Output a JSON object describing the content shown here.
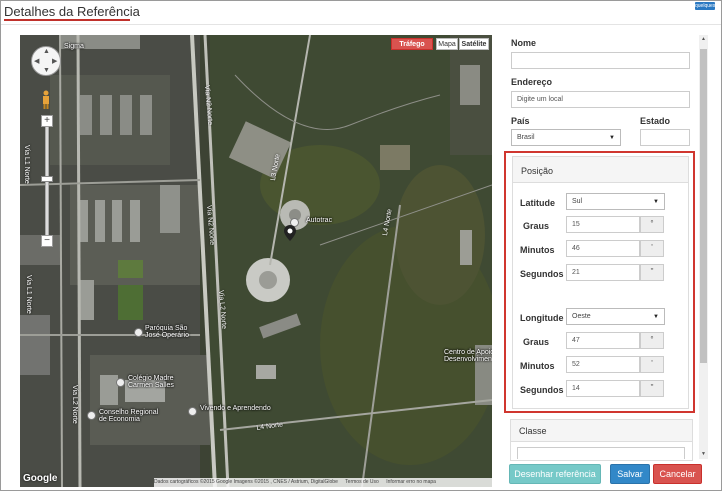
{
  "window": {
    "title": "Detalhes da Referência",
    "badge": "quelques"
  },
  "map": {
    "buttons": {
      "traffic": "Tráfego",
      "map": "Mapa",
      "satellite": "Satélite"
    },
    "labels": {
      "sigma": "Sigma",
      "autotrac": "Autotrac",
      "paroquia": "Paróquia São\nJosé Operário",
      "colegio": "Colégio Madre\nCarmen Salles",
      "conselho": "Conselho Regional\nde Economia",
      "vivendo": "Vivendo e Aprendendo",
      "centro": "Centro de Apoio\nDesenvolvimen"
    },
    "roads": {
      "via_l1a": "Via L1 Norte",
      "via_l1b": "Via L1 Norte",
      "via_l2a": "Via L2 Norte",
      "via_l2b": "Via L2 Norte",
      "via_n2a": "Via N2 Norte",
      "via_n2b": "Via N2 Norte",
      "l3": "L3 Norte",
      "l4": "L4 Norte",
      "bottom": "L4 Norte"
    },
    "google": "Google",
    "attribution": {
      "data": "Dados cartográficos ©2015 Google Imagens ©2015 , CNES / Astrium, DigitalGlobe",
      "terms": "Termos de Uso",
      "report": "Informar erro no mapa"
    }
  },
  "form": {
    "name_label": "Nome",
    "name_value": "",
    "address_label": "Endereço",
    "address_placeholder": "Digite um local",
    "country_label": "País",
    "country_value": "Brasil",
    "state_label": "Estado",
    "state_value": ""
  },
  "position": {
    "title": "Posição",
    "latitude": {
      "label": "Latitude",
      "direction": "Sul",
      "degrees_label": "Graus",
      "degrees": "15",
      "degrees_unit": "°",
      "minutes_label": "Minutos",
      "minutes": "46",
      "minutes_unit": "'",
      "seconds_label": "Segundos",
      "seconds": "21",
      "seconds_unit": "''"
    },
    "longitude": {
      "label": "Longitude",
      "direction": "Oeste",
      "degrees_label": "Graus",
      "degrees": "47",
      "degrees_unit": "°",
      "minutes_label": "Minutos",
      "minutes": "52",
      "minutes_unit": "'",
      "seconds_label": "Segundos",
      "seconds": "14",
      "seconds_unit": "''"
    }
  },
  "classe": {
    "title": "Classe"
  },
  "buttons": {
    "draw": "Desenhar referência",
    "save": "Salvar",
    "cancel": "Cancelar"
  },
  "colors": {
    "accent_red": "#d0362f",
    "save_blue": "#3288c8",
    "draw_teal": "#76c9c8",
    "cancel_red": "#d9534f"
  }
}
